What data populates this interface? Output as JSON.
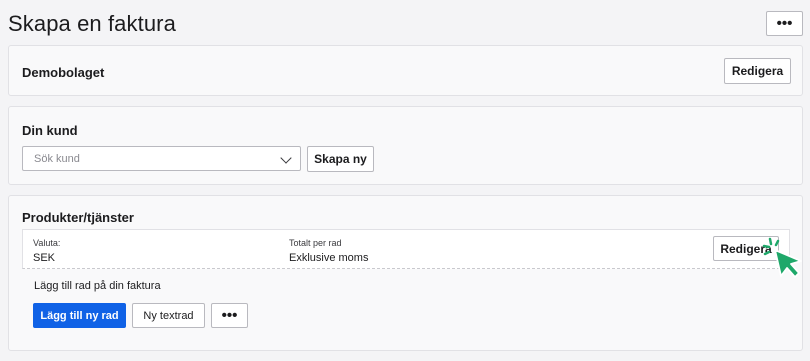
{
  "page": {
    "title": "Skapa en faktura",
    "more_label": "•••"
  },
  "company": {
    "name": "Demobolaget",
    "edit_label": "Redigera"
  },
  "customer": {
    "title": "Din kund",
    "search_placeholder": "Sök kund",
    "create_label": "Skapa ny"
  },
  "products": {
    "title": "Produkter/tjänster",
    "currency_label": "Valuta:",
    "currency_value": "SEK",
    "total_label": "Totalt per rad",
    "total_value": "Exklusive moms",
    "edit_label": "Redigera",
    "add_row_text": "Lägg till rad på din faktura",
    "add_new_row_label": "Lägg till ny rad",
    "new_text_row_label": "Ny textrad",
    "more_label": "•••"
  },
  "colors": {
    "primary": "#1062e6",
    "cursor": "#1fa86a"
  },
  "icons": {
    "chevron": "chevron-down-icon",
    "cursor": "pointer-cursor-icon"
  }
}
